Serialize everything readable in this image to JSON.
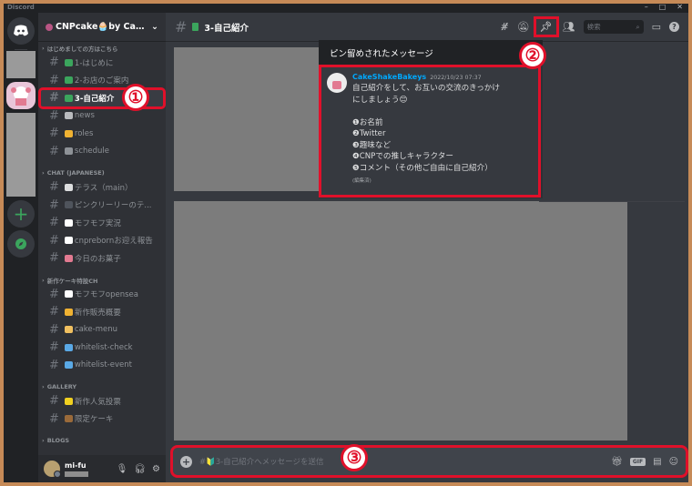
{
  "app": {
    "title": "Discord",
    "window_buttons": [
      "–",
      "□",
      "✕"
    ]
  },
  "guild": {
    "name": "CNPcake🧁by Cak..."
  },
  "sidebar": {
    "categories": [
      {
        "name": "はじめましての方はこちら",
        "channels": [
          {
            "label": "1-はじめに",
            "emoji_color": "#3ba55d"
          },
          {
            "label": "2-お店のご案内",
            "emoji_color": "#3ba55d"
          },
          {
            "label": "3-自己紹介",
            "emoji_color": "#3ba55d",
            "active": true
          },
          {
            "label": "news",
            "emoji_color": "#b9bbbe"
          },
          {
            "label": "roles",
            "emoji_color": "#f0b232"
          },
          {
            "label": "schedule",
            "emoji_color": "#8e9297"
          }
        ]
      },
      {
        "name": "CHAT (JAPANESE)",
        "channels": [
          {
            "label": "テラス（main）",
            "emoji_color": "#dcddde"
          },
          {
            "label": "ピンクリーリーのテ...",
            "emoji_color": "#4f545c"
          },
          {
            "label": "モフモフ実況",
            "emoji_color": "#ffffff"
          },
          {
            "label": "cnprebornお迎え報告",
            "emoji_color": "#ffffff"
          },
          {
            "label": "今日のお菓子",
            "emoji_color": "#e27a91"
          }
        ]
      },
      {
        "name": "新作ケーキ特設CH",
        "channels": [
          {
            "label": "モフモフopensea",
            "emoji_color": "#ffffff"
          },
          {
            "label": "新作販売概要",
            "emoji_color": "#f0b232"
          },
          {
            "label": "cake-menu",
            "emoji_color": "#f0c060"
          },
          {
            "label": "whitelist-check",
            "emoji_color": "#5aa9e6"
          },
          {
            "label": "whitelist-event",
            "emoji_color": "#5aa9e6"
          }
        ]
      },
      {
        "name": "GALLERY",
        "channels": [
          {
            "label": "新作人気投票",
            "emoji_color": "#f0d020"
          },
          {
            "label": "限定ケーキ",
            "emoji_color": "#9a6a3a"
          }
        ]
      },
      {
        "name": "BLOGS",
        "channels": []
      }
    ]
  },
  "user": {
    "name": "mi-fu"
  },
  "channel": {
    "title": "3-自己紹介"
  },
  "topbar": {
    "search_placeholder": "検索"
  },
  "pinned": {
    "header": "ピン留めされたメッセージ",
    "author": "CakeShakeBakeys",
    "timestamp": "2022/10/23 07:37",
    "lines": [
      "自己紹介をして、お互いの交流のきっかけ",
      "にしましょう😊",
      "",
      "❶お名前",
      "❷Twitter",
      "❸趣味など",
      "❹CNPでの推しキャラクター",
      "❺コメント（その他ご自由に自己紹介）"
    ],
    "edited": "(編集済)"
  },
  "composer": {
    "placeholder": "#🔰3-自己紹介へメッセージを送信"
  },
  "callouts": {
    "one": "①",
    "two": "②",
    "three": "③"
  },
  "colors": {
    "highlight": "#e0102a",
    "mention_blue": "#00a8fc",
    "bg_main": "#36393f",
    "bg_sidebar": "#2f3136"
  }
}
